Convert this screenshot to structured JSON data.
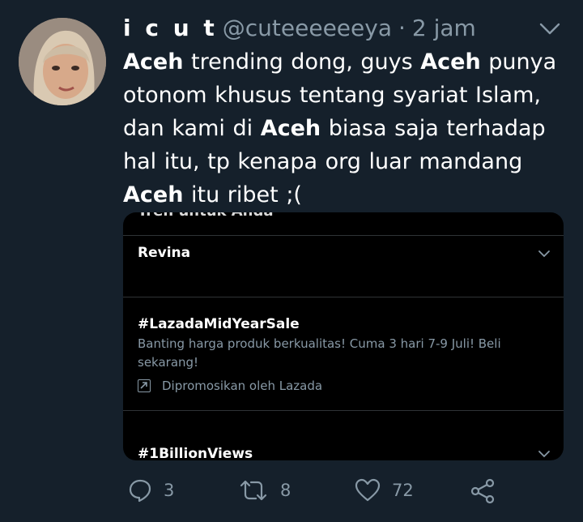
{
  "tweet": {
    "display_name": "i c u t",
    "handle": "@cuteeeeeeya",
    "separator": "·",
    "time": "2 jam",
    "body": [
      {
        "text": "Aceh",
        "bold": true
      },
      {
        "text": " trending dong, guys ",
        "bold": false
      },
      {
        "text": "Aceh",
        "bold": true
      },
      {
        "text": " punya otonom khusus tentang syariat Islam, dan kami di ",
        "bold": false
      },
      {
        "text": "Aceh",
        "bold": true
      },
      {
        "text": " biasa saja terhadap hal itu, tp kenapa org luar mandang ",
        "bold": false
      },
      {
        "text": "Aceh",
        "bold": true
      },
      {
        "text": " itu ribet  ;(",
        "bold": false
      }
    ]
  },
  "embed": {
    "header": "Tren untuk Anda",
    "trends": [
      {
        "title": "Revina"
      },
      {
        "title": "#LazadaMidYearSale",
        "description": "Banting harga produk berkualitas! Cuma 3 hari 7-9 Juli! Beli sekarang!",
        "promoted": "Dipromosikan oleh Lazada"
      },
      {
        "title": "#1BillionViews"
      }
    ]
  },
  "actions": {
    "reply_count": "3",
    "retweet_count": "8",
    "like_count": "72"
  },
  "colors": {
    "background": "#15202b",
    "secondary_text": "#8899a6",
    "embed_bg": "#000000"
  },
  "icons": [
    "chevron-down-icon",
    "reply-icon",
    "retweet-icon",
    "like-icon",
    "share-icon",
    "promoted-icon"
  ]
}
